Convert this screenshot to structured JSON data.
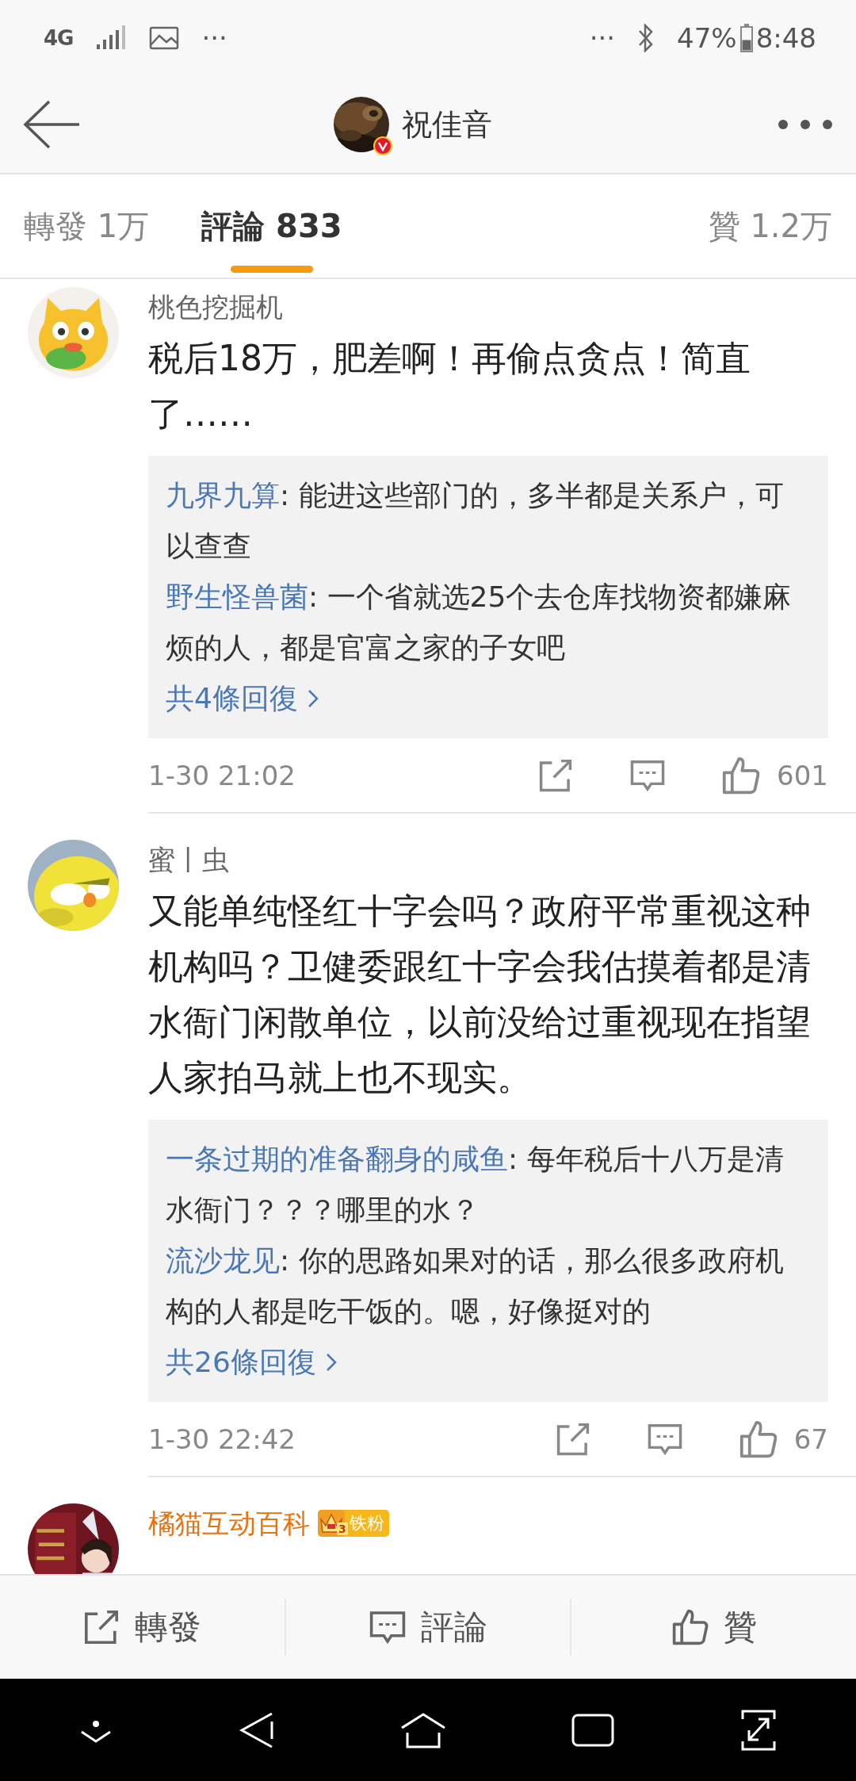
{
  "status_bar": {
    "network": "4G",
    "left_more": "···",
    "right_more": "···",
    "battery_text": "47%",
    "time": "8:48"
  },
  "header": {
    "title": "祝佳音",
    "verified": true
  },
  "tabs": [
    {
      "label": "轉發 1万",
      "selected": false
    },
    {
      "label": "評論 833",
      "selected": true
    },
    {
      "label": "贊 1.2万",
      "selected": false
    }
  ],
  "comments": [
    {
      "author": "桃色挖掘机",
      "vip": false,
      "text": "税后18万，肥差啊！再偷点贪点！简直了……",
      "replies": [
        {
          "author": "九界九算",
          "text": ": 能进这些部门的，多半都是关系户，可以查查"
        },
        {
          "author": "野生怪兽菌",
          "text": ": 一个省就选25个去仓库找物资都嫌麻烦的人，都是官富之家的子女吧"
        }
      ],
      "more_replies": "共4條回復",
      "time": "1-30 21:02",
      "likes": "601"
    },
    {
      "author": "蜜丨虫",
      "vip": false,
      "text": "又能单纯怪红十字会吗？政府平常重视这种机构吗？卫健委跟红十字会我估摸着都是清水衙门闲散单位，以前没给过重视现在指望人家拍马就上也不现实。",
      "replies": [
        {
          "author": "一条过期的准备翻身的咸鱼",
          "text": ": 每年税后十八万是清水衙门？？？哪里的水？"
        },
        {
          "author": "流沙龙见",
          "text": ": 你的思路如果对的话，那么很多政府机构的人都是吃干饭的。嗯，好像挺对的"
        }
      ],
      "more_replies": "共26條回復",
      "time": "1-30 22:42",
      "likes": "67"
    },
    {
      "author": "橘猫互动百科",
      "vip": true,
      "badge": {
        "level": "3",
        "label": "铁粉"
      }
    }
  ],
  "action_bar": [
    {
      "kind": "repost",
      "label": "轉發"
    },
    {
      "kind": "comment",
      "label": "評論"
    },
    {
      "kind": "like",
      "label": "贊"
    }
  ]
}
